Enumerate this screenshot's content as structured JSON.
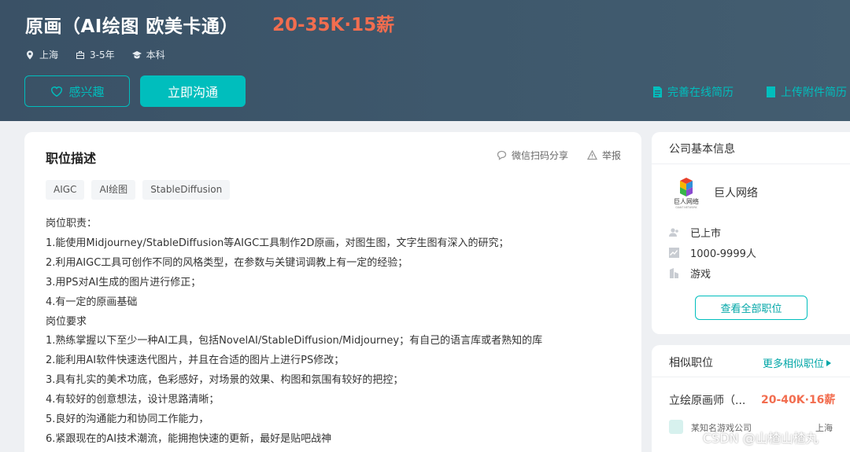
{
  "header": {
    "title": "原画（AI绘图 欧美卡通）",
    "salary": "20-35K·15薪",
    "meta": {
      "city": "上海",
      "experience": "3-5年",
      "education": "本科"
    },
    "interest_label": "感兴趣",
    "chat_label": "立即沟通",
    "online_resume_label": "完善在线简历",
    "upload_resume_label": "上传附件简历"
  },
  "job": {
    "section_title": "职位描述",
    "share_label": "微信扫码分享",
    "report_label": "举报",
    "tags": [
      "AIGC",
      "AI绘图",
      "StableDiffusion"
    ],
    "lines": [
      "岗位职责：",
      "1.能使用Midjourney/StableDiffusion等AIGC工具制作2D原画，对图生图，文字生图有深入的研究；",
      "2.利用AIGC工具可创作不同的风格类型，在参数与关键词调教上有一定的经验；",
      "3.用PS对AI生成的图片进行修正；",
      "4.有一定的原画基础",
      "岗位要求",
      "1.熟练掌握以下至少一种AI工具，包括NovelAI/StableDiffusion/Midjourney；有自己的语言库或者熟知的库",
      "2.能利用AI软件快速迭代图片，并且在合适的图片上进行PS修改；",
      "3.具有扎实的美术功底，色彩感好，对场景的效果、构图和氛围有较好的把控；",
      "4.有较好的创意想法，设计思路清晰；",
      "5.良好的沟通能力和协同工作能力，",
      "6.紧跟现在的AI技术潮流，能拥抱快速的更新，最好是贴吧战神"
    ]
  },
  "company": {
    "section_title": "公司基本信息",
    "name": "巨人网络",
    "logo_text": "巨人网络",
    "logo_subtext": "GIANT NETWORK",
    "stage": "已上市",
    "size": "1000-9999人",
    "industry": "游戏",
    "view_all_label": "查看全部职位"
  },
  "similar": {
    "section_title": "相似职位",
    "more_label": "更多相似职位",
    "job_title": "立绘原画师（...",
    "job_salary": "20-40K·16薪",
    "company": "某知名游戏公司",
    "city": "上海"
  },
  "watermark": "CSDN @山楂山楂丸",
  "colors": {
    "accent": "#00bebd",
    "salary": "#f26d4f",
    "header_bg": "#3e586c"
  }
}
